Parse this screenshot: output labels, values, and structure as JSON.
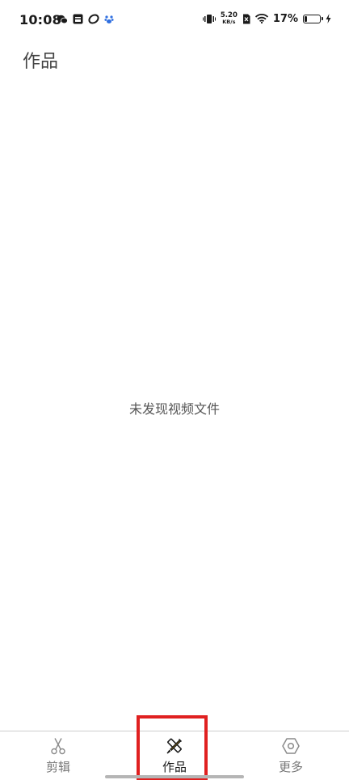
{
  "status_bar": {
    "time": "10:08",
    "net_speed_value": "5.20",
    "net_speed_unit": "KB/s",
    "battery_percent": "17%",
    "battery_level": 0.17
  },
  "header": {
    "title": "作品"
  },
  "main": {
    "empty_message": "未发现视频文件"
  },
  "bottom_nav": {
    "items": [
      {
        "label": "剪辑",
        "icon": "scissors-icon",
        "active": false
      },
      {
        "label": "作品",
        "icon": "pencil-ruler-icon",
        "active": true
      },
      {
        "label": "更多",
        "icon": "hexagon-settings-icon",
        "active": false
      }
    ]
  },
  "colors": {
    "highlight": "#e02020",
    "active_icon": "#d9a400",
    "inactive": "#777777"
  }
}
